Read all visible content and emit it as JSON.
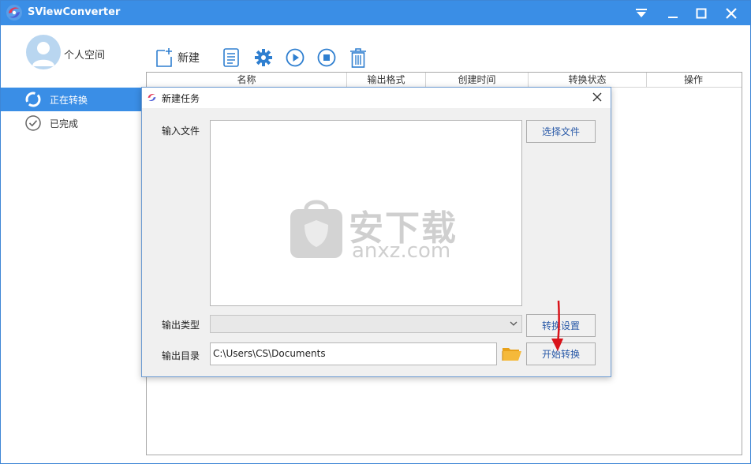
{
  "window": {
    "title": "SViewConverter"
  },
  "user": {
    "name": "个人空间"
  },
  "nav": {
    "items": [
      {
        "label": "正在转换",
        "active": true
      },
      {
        "label": "已完成",
        "active": false
      }
    ]
  },
  "toolbar": {
    "new_label": "新建"
  },
  "table": {
    "columns": [
      "名称",
      "输出格式",
      "创建时间",
      "转换状态",
      "操作"
    ]
  },
  "dialog": {
    "title": "新建任务",
    "input_file_label": "输入文件",
    "choose_file_button": "选择文件",
    "output_type_label": "输出类型",
    "output_type_value": "",
    "convert_settings_button": "转换设置",
    "output_dir_label": "输出目录",
    "output_dir_value": "C:\\Users\\CS\\Documents",
    "start_convert_button": "开始转换"
  },
  "watermark": {
    "cn": "安下载",
    "en": "anxz.com"
  },
  "colors": {
    "accent": "#3a8ee6",
    "link_text": "#2a5aa8",
    "arrow": "#d9131a"
  }
}
